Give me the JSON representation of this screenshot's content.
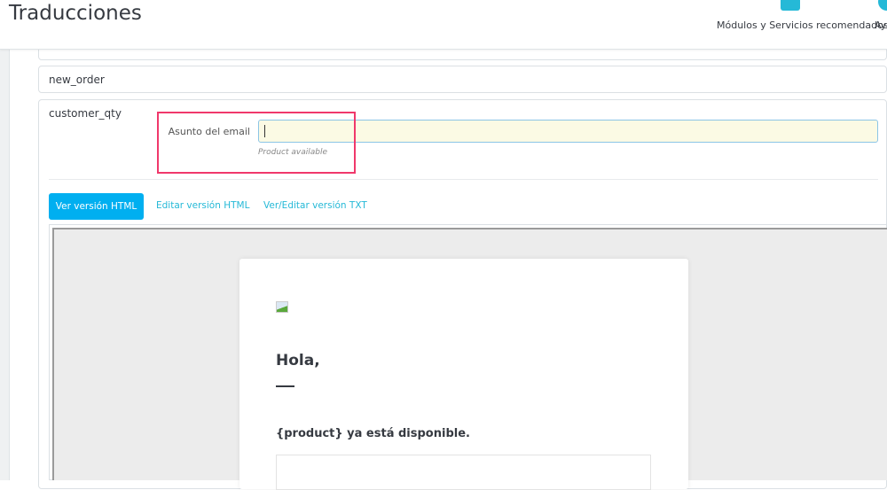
{
  "header": {
    "title": "Traducciones",
    "modules_label": "Módulos y Servicios recomendados",
    "help_label": "Ayuda"
  },
  "cards": {
    "new_order": "new_order",
    "customer_qty": "customer_qty"
  },
  "subject": {
    "label": "Asunto del email",
    "value": "",
    "hint": "Product available"
  },
  "tabs": [
    {
      "label": "Ver versión HTML",
      "active": true
    },
    {
      "label": "Editar versión HTML"
    },
    {
      "label": "Ver/Editar versión TXT"
    }
  ],
  "preview": {
    "greeting": "Hola,",
    "message": "{product} ya está disponible."
  },
  "colors": {
    "accent": "#00aff0",
    "highlight": "#f0386b",
    "input_bg": "#fbfae4"
  }
}
